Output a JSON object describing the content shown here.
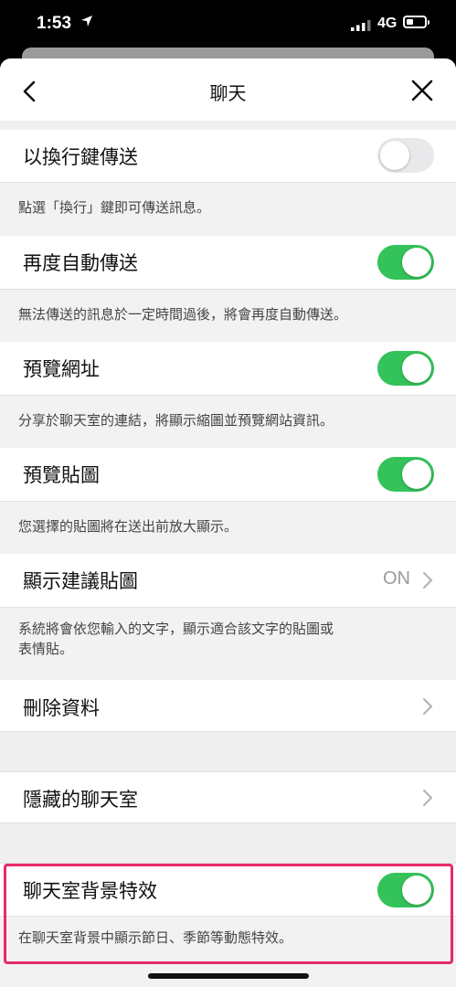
{
  "status": {
    "time": "1:53",
    "network": "4G"
  },
  "header": {
    "title": "聊天"
  },
  "settings": [
    {
      "label": "以換行鍵傳送",
      "toggle": "off",
      "desc": "點選「換行」鍵即可傳送訊息。"
    },
    {
      "label": "再度自動傳送",
      "toggle": "on",
      "desc": "無法傳送的訊息於一定時間過後，將會再度自動傳送。"
    },
    {
      "label": "預覽網址",
      "toggle": "on",
      "desc": "分享於聊天室的連結，將顯示縮圖並預覽網站資訊。"
    },
    {
      "label": "預覽貼圖",
      "toggle": "on",
      "desc": "您選擇的貼圖將在送出前放大顯示。"
    },
    {
      "label": "顯示建議貼圖",
      "value": "ON",
      "desc1": "系統將會依您輸入的文字，顯示適合該文字的貼圖或",
      "desc2": "表情貼。"
    },
    {
      "label": "刪除資料"
    },
    {
      "label": "隱藏的聊天室"
    },
    {
      "label": "聊天室背景特效",
      "toggle": "on",
      "desc": "在聊天室背景中顯示節日、季節等動態特效。"
    }
  ],
  "colors": {
    "toggle_on": "#34c35a",
    "highlight": "#e8296a"
  }
}
